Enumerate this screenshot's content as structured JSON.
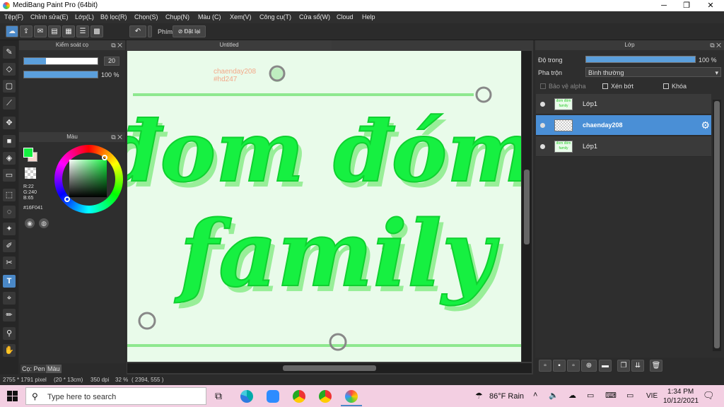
{
  "window": {
    "title": "MediBang Paint Pro (64bit)",
    "minimize": "─",
    "maximize": "❐",
    "close": "✕"
  },
  "menu": [
    "Tệp(F)",
    "Chỉnh sửa(E)",
    "Lớp(L)",
    "Bộ lọc(R)",
    "Chọn(S)",
    "Chụp(N)",
    "Màu (C)",
    "Xem(V)",
    "Công cụ(T)",
    "Cửa sổ(W)",
    "Cloud",
    "Help"
  ],
  "toolbar": {
    "undo_icon": "undo-arrow",
    "key_label": "Phím",
    "reset_label": "Đặt lại"
  },
  "brush_panel": {
    "title": "Kiểm soát cọ",
    "size_value": "20",
    "size_fill": 0.3,
    "opacity_value": "100 %",
    "opacity_fill": 1.0
  },
  "color_panel": {
    "title": "Màu",
    "rgb": {
      "r": "R:22",
      "g": "G:240",
      "b": "B:65"
    },
    "hex": "#16F041",
    "fg_color": "#16F041",
    "bg_color": "#F7D7CF"
  },
  "left_tabs": {
    "pen": "Cọ: Pen",
    "color": "Màu"
  },
  "document": {
    "tab": "Untitled",
    "watermark_line1": "chaenday208",
    "watermark_line2": "#hd247",
    "text_line1": "đom đóm",
    "text_line2": "family",
    "text_color": "#16F041"
  },
  "layer_panel": {
    "title": "Lớp",
    "opacity_label": "Độ trong",
    "opacity_value": "100 %",
    "blend_label": "Pha trộn",
    "blend_value": "Bình thường",
    "protect_alpha": "Bảo vệ alpha",
    "clipping": "Xén bớt",
    "lock": "Khóa",
    "layers": [
      {
        "name": "Lớp1",
        "thumb": "đom đóm family",
        "selected": false
      },
      {
        "name": "chaenday208",
        "thumb": "",
        "selected": true
      },
      {
        "name": "Lớp1",
        "thumb": "đom đóm family",
        "selected": false
      }
    ]
  },
  "status": {
    "dims": "2755 * 1791 pixel",
    "size_cm": "(20 * 13cm)",
    "dpi": "350 dpi",
    "zoom": "32 %",
    "coords": "( 2394, 555 )"
  },
  "taskbar": {
    "search_placeholder": "Type here to search",
    "weather": "86°F  Rain",
    "lang": "VIE",
    "time": "1:34 PM",
    "date": "10/12/2021"
  }
}
